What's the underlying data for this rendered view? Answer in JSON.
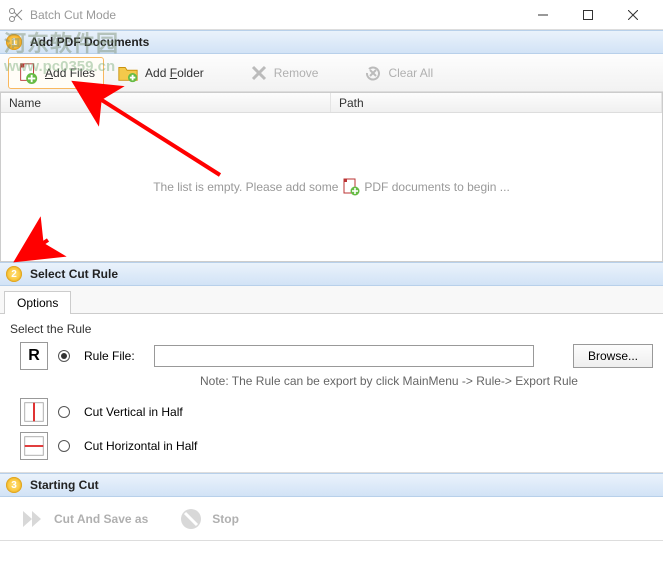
{
  "window": {
    "title": "Batch Cut Mode"
  },
  "step1": {
    "title": "Add PDF Documents",
    "toolbar": {
      "add_files": "Add Files",
      "add_folder": "Add Folder",
      "remove": "Remove",
      "clear_all": "Clear All"
    },
    "columns": {
      "name": "Name",
      "path": "Path"
    },
    "empty_prefix": "The list is empty. Please add some",
    "empty_suffix": "PDF documents to begin ..."
  },
  "step2": {
    "title": "Select Cut Rule",
    "tab": "Options",
    "heading": "Select the Rule",
    "rule_file_label": "Rule File:",
    "browse": "Browse...",
    "note": "Note: The Rule can be export by click MainMenu -> Rule-> Export Rule",
    "rule_vert": "Cut Vertical in Half",
    "rule_horiz": "Cut Horizontal in Half",
    "rule_file_icon_letter": "R"
  },
  "step3": {
    "title": "Starting Cut",
    "cut_save": "Cut And Save as",
    "stop": "Stop"
  },
  "watermark": {
    "line1": "河东软件园",
    "line2": "www.pc0359.cn"
  }
}
